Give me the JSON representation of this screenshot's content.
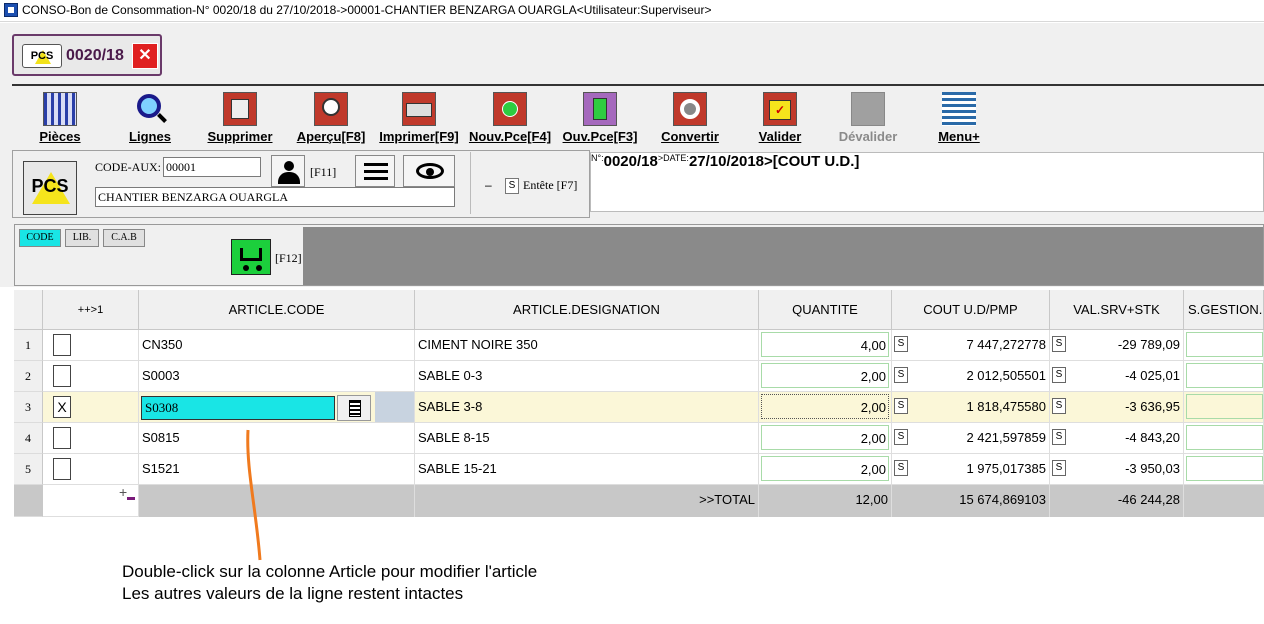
{
  "window": {
    "title": "CONSO-Bon de Consommation-N° 0020/18 du 27/10/2018->00001-CHANTIER BENZARGA OUARGLA<Utilisateur:Superviseur>"
  },
  "doc_tab": {
    "icon_text": "PCS",
    "number": "0020/18",
    "close_label": "✕"
  },
  "toolbar": {
    "items": [
      {
        "label": "Pièces"
      },
      {
        "label": "Lignes"
      },
      {
        "label": "Supprimer"
      },
      {
        "label": "Aperçu[F8]"
      },
      {
        "label": "Imprimer[F9]"
      },
      {
        "label": "Nouv.Pce[F4]"
      },
      {
        "label": "Ouv.Pce[F3]"
      },
      {
        "label": "Convertir"
      },
      {
        "label": "Valider"
      },
      {
        "label": "Dévalider"
      },
      {
        "label": "Menu+"
      }
    ]
  },
  "header": {
    "icon_text": "PCS",
    "code_aux_label": "CODE-AUX:",
    "code_aux_value": "00001",
    "f11_label": "[F11]",
    "name_value": "CHANTIER BENZARGA OUARGLA",
    "entete_minus": "–",
    "entete_s": "S",
    "entete_label": "Entête [F7]"
  },
  "info": {
    "n_label": "N°:",
    "number": "0020/18",
    "date_label": ">DATE:",
    "date": "27/10/2018",
    "mode": ">[COUT U.D.]"
  },
  "option_tabs": {
    "code": "CODE",
    "lib": "LIB.",
    "cab": "C.A.B",
    "f12_label": "[F12]"
  },
  "grid": {
    "columns": [
      "++>1",
      "ARTICLE.CODE",
      "ARTICLE.DESIGNATION",
      "QUANTITE",
      "COUT U.D/PMP",
      "VAL.SRV+STK",
      "S.GESTION.C"
    ],
    "rows": [
      {
        "n": "1",
        "check": "",
        "code": "CN350",
        "designation": "CIMENT NOIRE 350",
        "qty": "4,00",
        "cost": "7 447,272778",
        "val": "-29 789,09"
      },
      {
        "n": "2",
        "check": "",
        "code": "S0003",
        "designation": "SABLE 0-3",
        "qty": "2,00",
        "cost": "2 012,505501",
        "val": "-4 025,01"
      },
      {
        "n": "3",
        "check": "X",
        "code": "S0308",
        "designation": "SABLE 3-8",
        "qty": "2,00",
        "cost": "1 818,475580",
        "val": "-3 636,95"
      },
      {
        "n": "4",
        "check": "",
        "code": "S0815",
        "designation": "SABLE 8-15",
        "qty": "2,00",
        "cost": "2 421,597859",
        "val": "-4 843,20"
      },
      {
        "n": "5",
        "check": "",
        "code": "S1521",
        "designation": "SABLE 15-21",
        "qty": "2,00",
        "cost": "1 975,017385",
        "val": "-3 950,03"
      }
    ],
    "s_label": "S",
    "total": {
      "label": ">>TOTAL",
      "qty": "12,00",
      "cost": "15 674,869103",
      "val": "-46 244,28"
    },
    "add_icon": "+"
  },
  "annotation": {
    "line1": "Double-click sur la colonne Article pour modifier l'article",
    "line2": "Les autres valeurs de la ligne restent intactes"
  },
  "colors": {
    "accent_cyan": "#19e5e5",
    "selected_row": "#fbf7d8",
    "arrow_orange": "#f07a1e",
    "close_red": "#e02020"
  }
}
